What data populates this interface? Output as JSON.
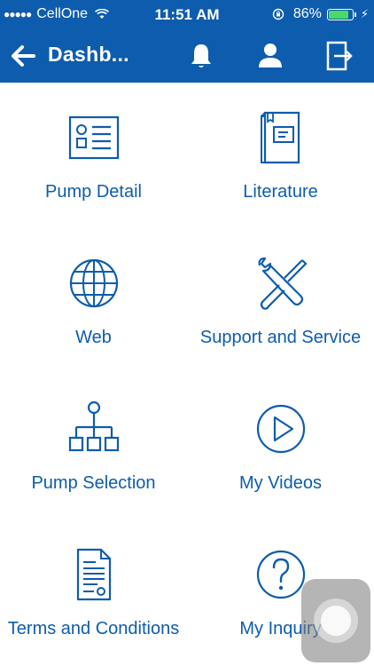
{
  "status_bar": {
    "carrier": "CellOne",
    "time": "11:51 AM",
    "battery": "86%",
    "battery_level": 0.86
  },
  "nav": {
    "title": "Dashb..."
  },
  "tiles": [
    {
      "label": "Pump Detail",
      "icon": "contact-card-icon"
    },
    {
      "label": "Literature",
      "icon": "book-icon"
    },
    {
      "label": "Web",
      "icon": "globe-icon"
    },
    {
      "label": "Support and Service",
      "icon": "tools-icon"
    },
    {
      "label": "Pump Selection",
      "icon": "org-chart-icon"
    },
    {
      "label": "My Videos",
      "icon": "play-circle-icon"
    },
    {
      "label": "Terms and Conditions",
      "icon": "document-icon"
    },
    {
      "label": "My Inquiry",
      "icon": "question-circle-icon"
    }
  ],
  "colors": {
    "brand": "#0E5CAD",
    "background": "#FFFFFF",
    "battery_fill": "#4CD964"
  }
}
